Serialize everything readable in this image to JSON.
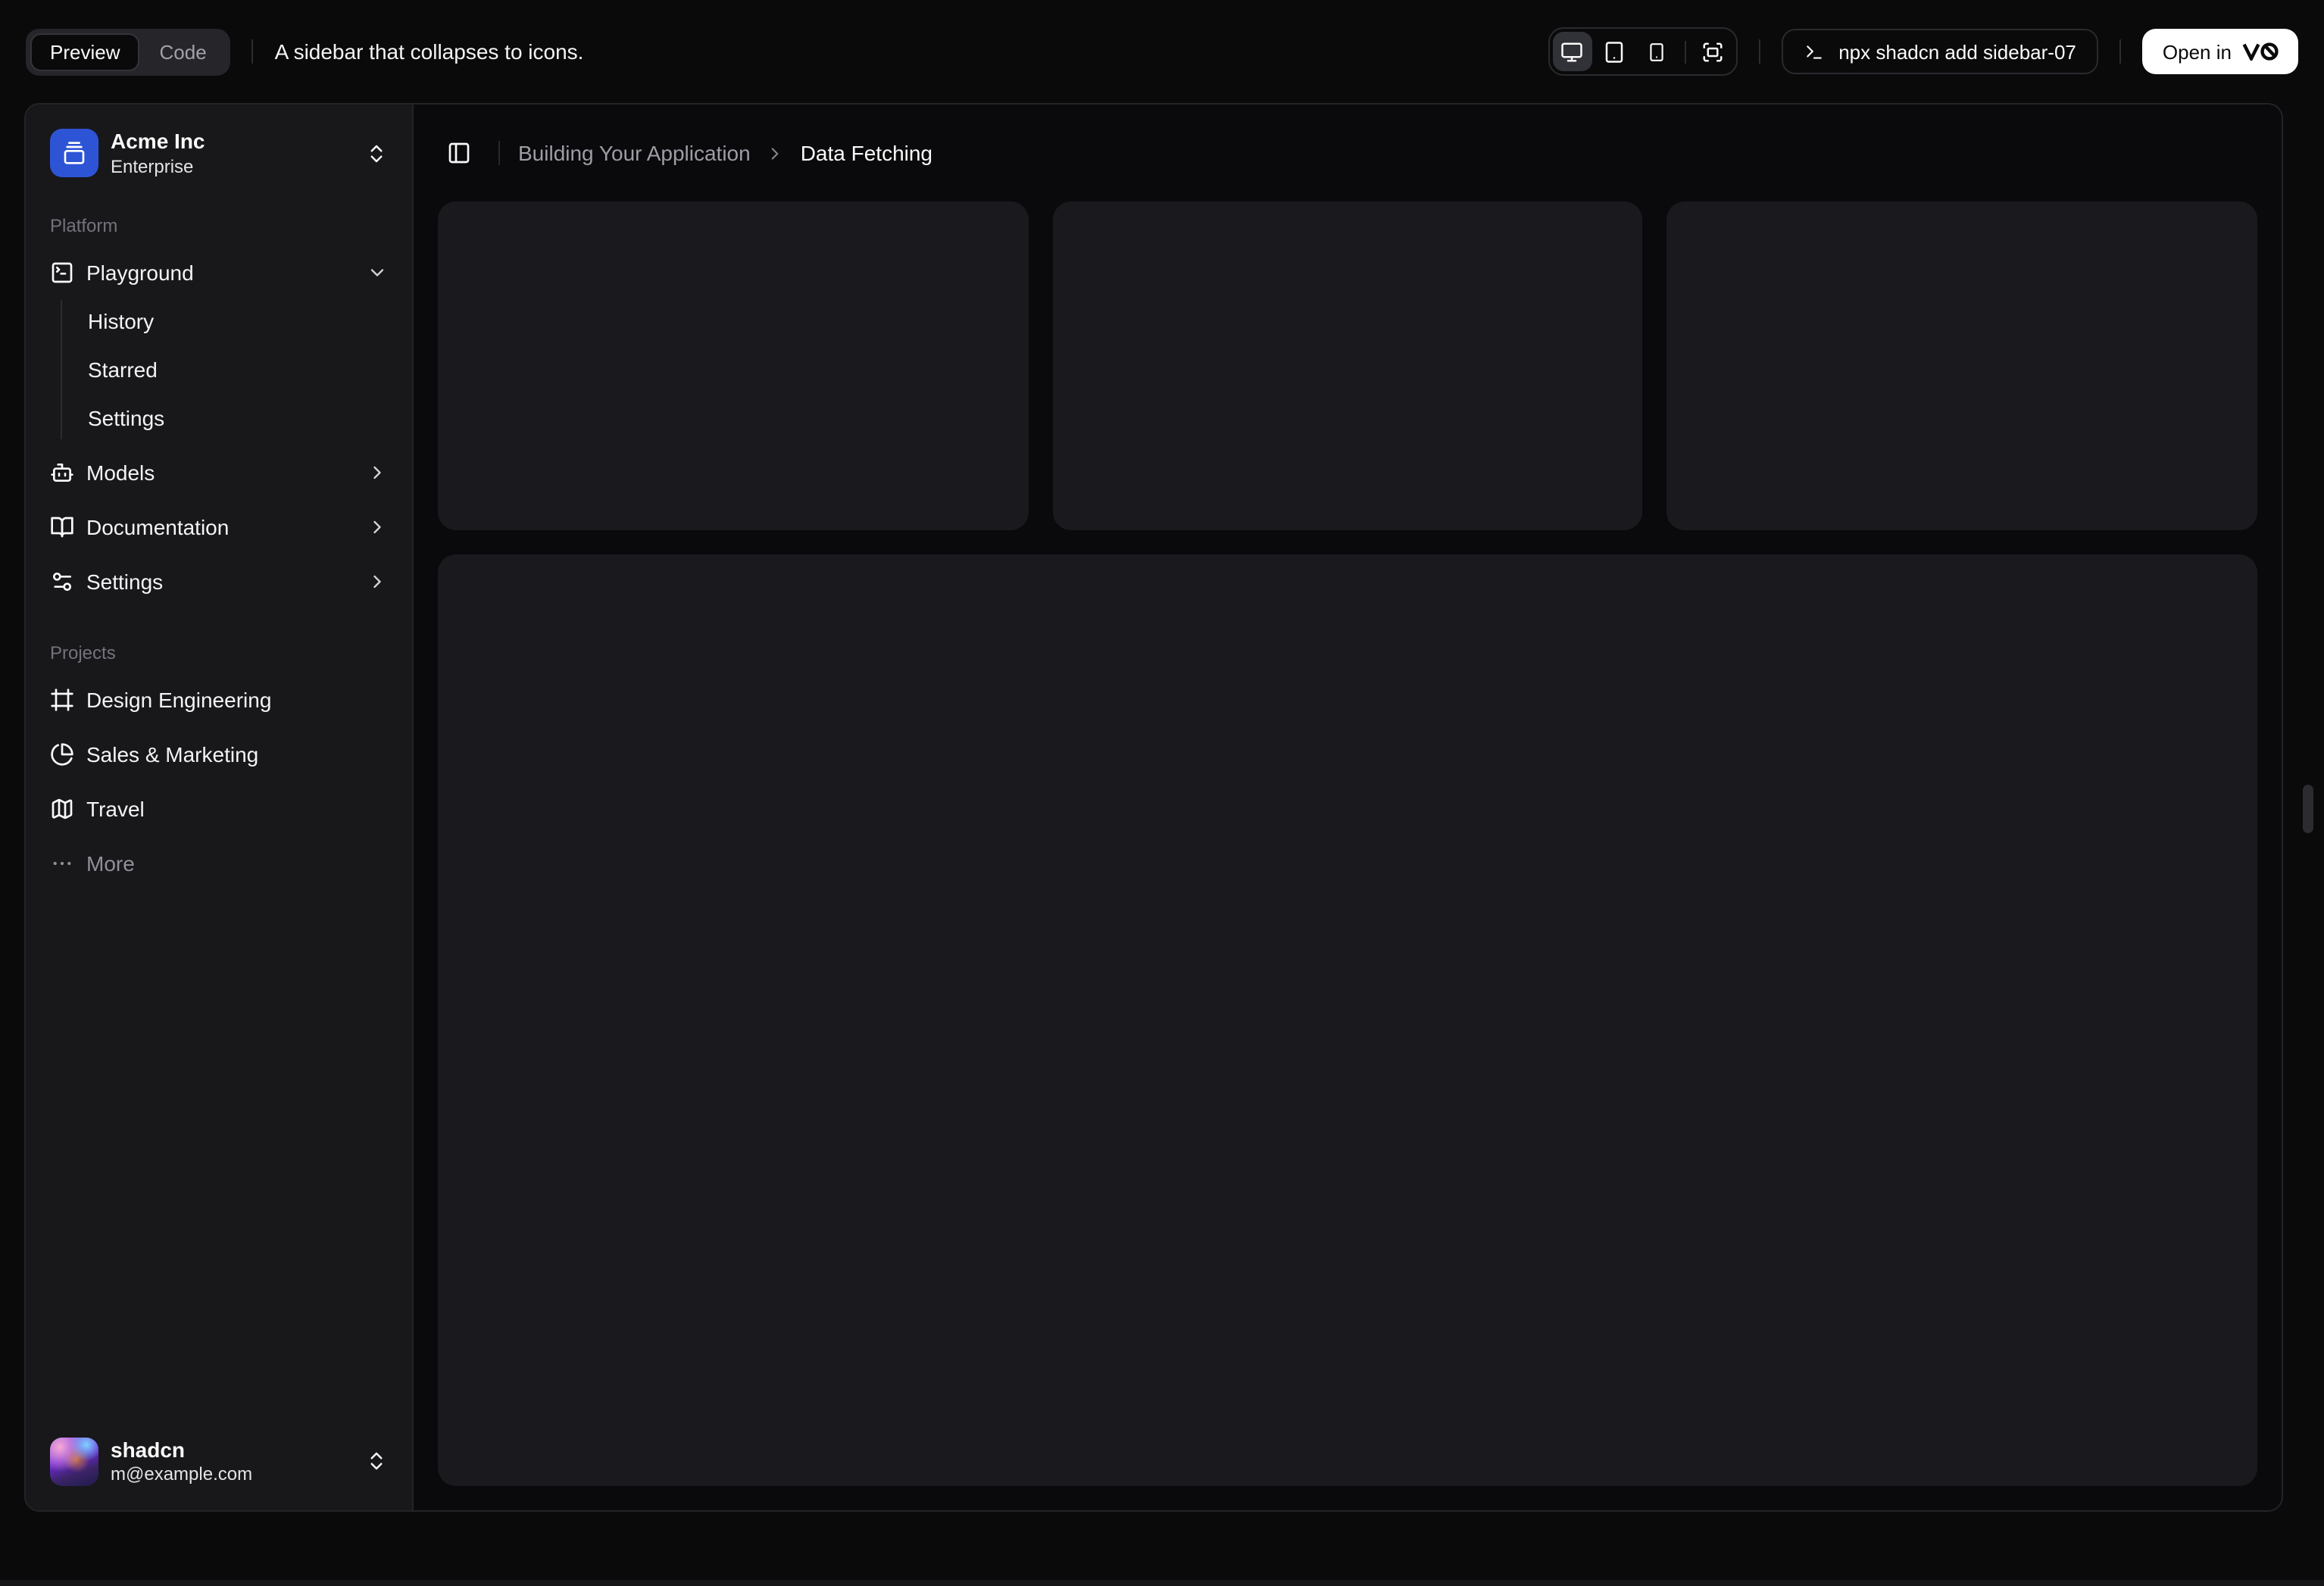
{
  "toolbar": {
    "preview_label": "Preview",
    "code_label": "Code",
    "description": "A sidebar that collapses to icons.",
    "command": "npx shadcn add sidebar-07",
    "open_in_label": "Open in",
    "device_icons": [
      "monitor-icon",
      "tablet-icon",
      "smartphone-icon",
      "fullscreen-icon"
    ],
    "open_in_logo": "v0-logo-icon"
  },
  "sidebar": {
    "team": {
      "name": "Acme Inc",
      "plan": "Enterprise",
      "icon": "gallery-vertical-end-icon",
      "logo_color": "#2e54d6"
    },
    "platform": {
      "label": "Platform",
      "items": [
        {
          "label": "Playground",
          "icon": "square-terminal-icon",
          "expanded": true,
          "children": [
            "History",
            "Starred",
            "Settings"
          ]
        },
        {
          "label": "Models",
          "icon": "bot-icon"
        },
        {
          "label": "Documentation",
          "icon": "book-open-icon"
        },
        {
          "label": "Settings",
          "icon": "settings-sliders-icon"
        }
      ]
    },
    "projects": {
      "label": "Projects",
      "items": [
        {
          "label": "Design Engineering",
          "icon": "frame-icon"
        },
        {
          "label": "Sales & Marketing",
          "icon": "pie-chart-icon"
        },
        {
          "label": "Travel",
          "icon": "map-icon"
        },
        {
          "label": "More",
          "icon": "more-horizontal-icon"
        }
      ]
    },
    "user": {
      "name": "shadcn",
      "email": "m@example.com"
    }
  },
  "breadcrumb": {
    "parent": "Building Your Application",
    "current": "Data Fetching"
  },
  "colors": {
    "page_bg": "#0a0a0b",
    "sidebar_bg": "#18181b",
    "content_bg": "#0a0a0c",
    "card_bg": "#1a1a1e",
    "accent_blue": "#2e54d6",
    "text_primary": "#fafafa",
    "text_muted": "#a1a1aa"
  }
}
